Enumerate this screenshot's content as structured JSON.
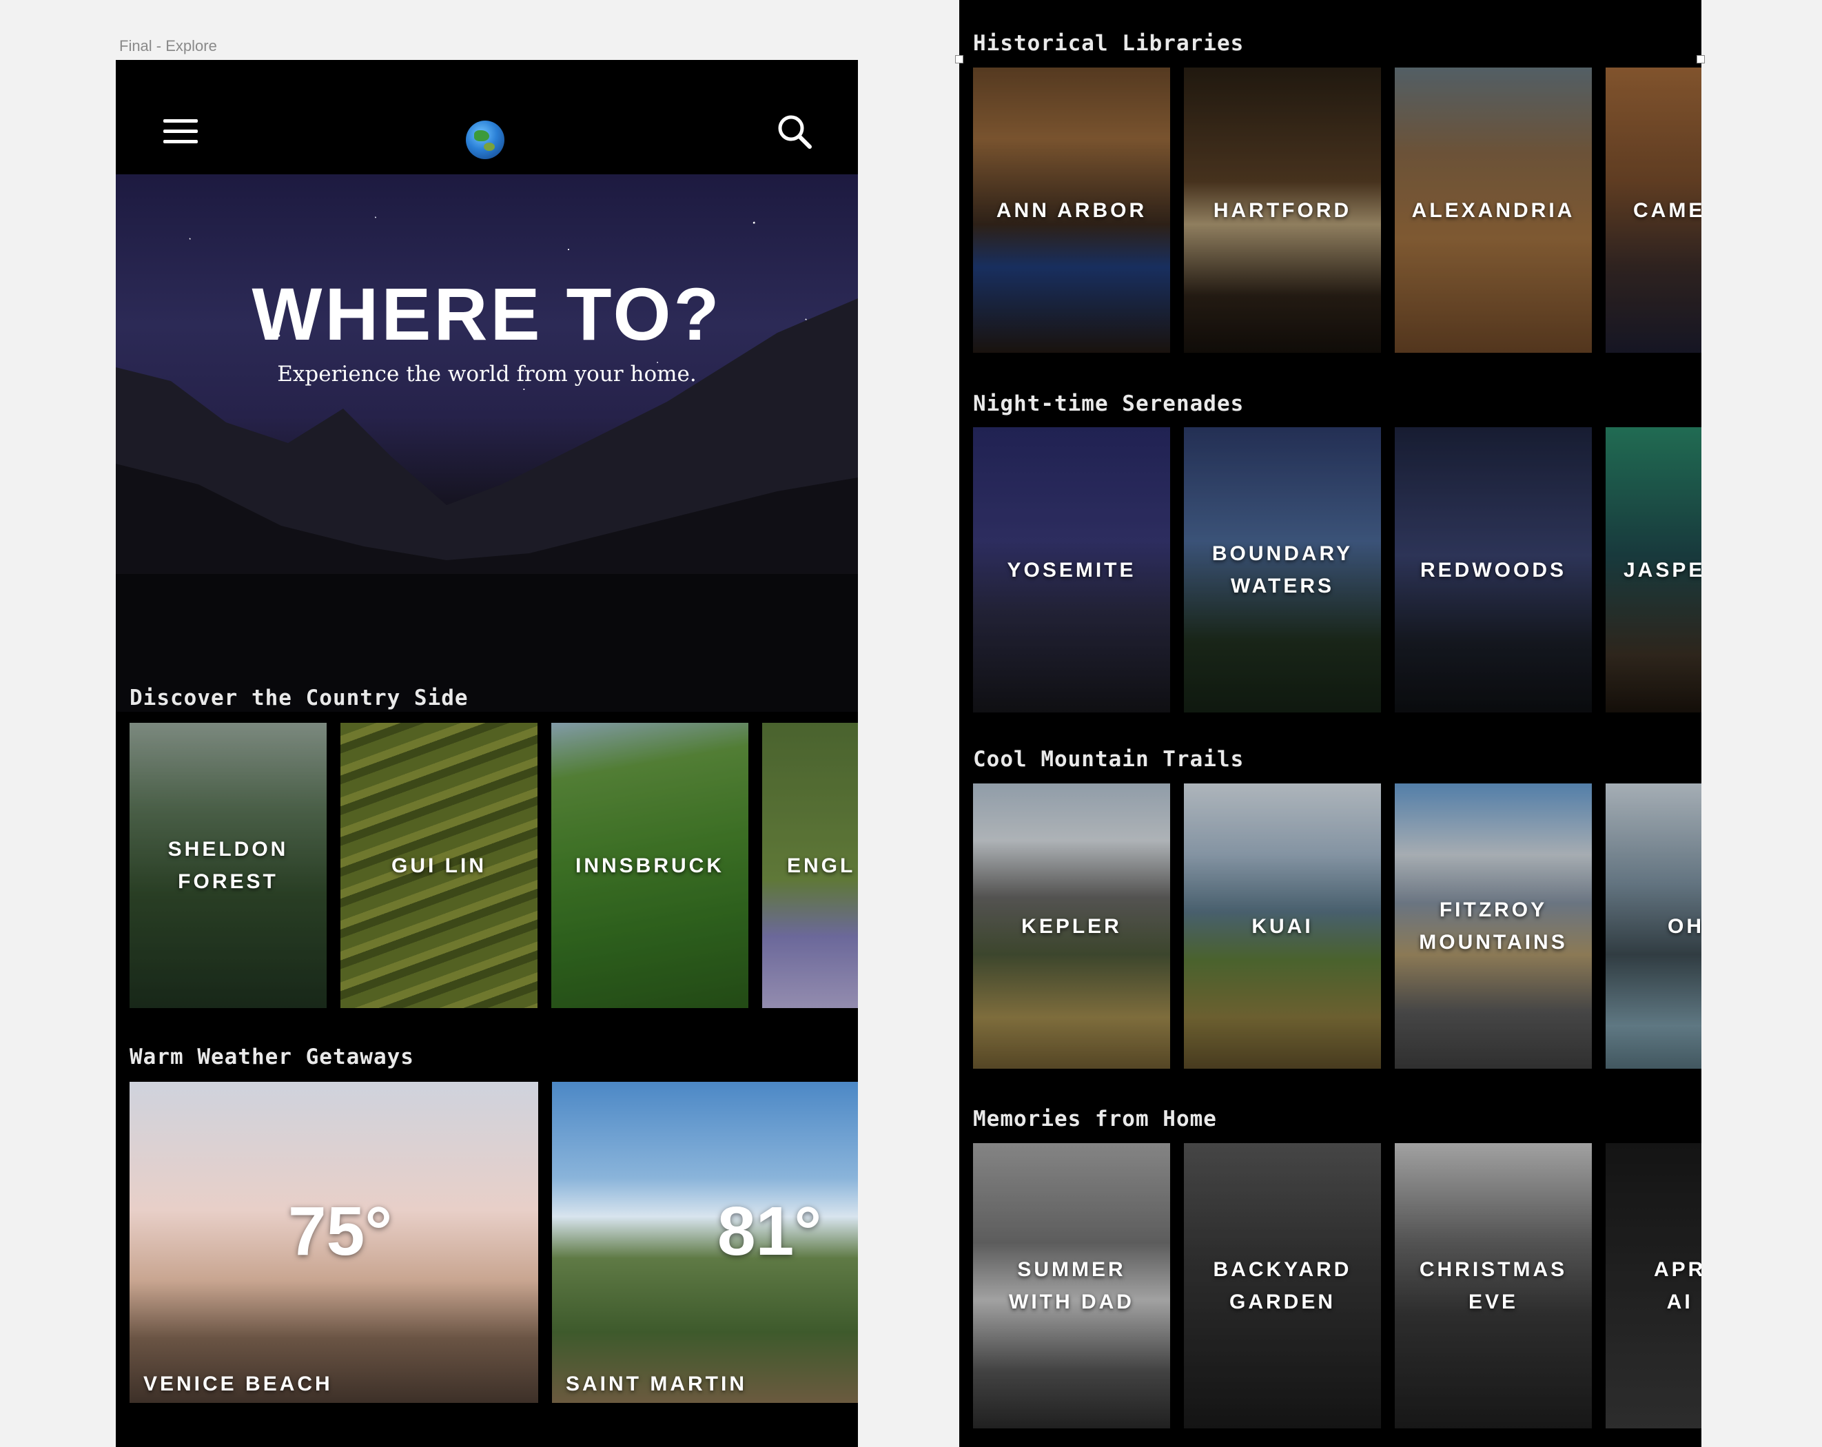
{
  "artboard": {
    "label": "Final - Explore"
  },
  "header": {
    "menu_icon": "hamburger-menu-icon",
    "logo_icon": "globe-icon",
    "search_icon": "search-icon"
  },
  "hero": {
    "title": "WHERE TO?",
    "subtitle": "Experience the world from your home."
  },
  "sections": {
    "country": {
      "title": "Discover the Country Side",
      "cards": [
        "SHELDON\nFOREST",
        "GUI LIN",
        "INNSBRUCK",
        "ENGL"
      ]
    },
    "warm": {
      "title": "Warm Weather Getaways",
      "cards": [
        {
          "temp": "75°",
          "label": "VENICE BEACH"
        },
        {
          "temp": "81°",
          "label": "SAINT MARTIN"
        }
      ]
    },
    "libraries": {
      "title": "Historical Libraries",
      "cards": [
        "ANN ARBOR",
        "HARTFORD",
        "ALEXANDRIA",
        "CAME"
      ]
    },
    "night": {
      "title": "Night-time Serenades",
      "cards": [
        "YOSEMITE",
        "BOUNDARY\nWATERS",
        "REDWOODS",
        "JASPE"
      ]
    },
    "mountain": {
      "title": "Cool Mountain Trails",
      "cards": [
        "KEPLER",
        "KUAI",
        "FITZROY\nMOUNTAINS",
        "OH"
      ]
    },
    "memories": {
      "title": "Memories from Home",
      "cards": [
        "SUMMER\nWITH DAD",
        "BACKYARD\nGARDEN",
        "CHRISTMAS\nEVE",
        "APR\nAI"
      ]
    }
  }
}
